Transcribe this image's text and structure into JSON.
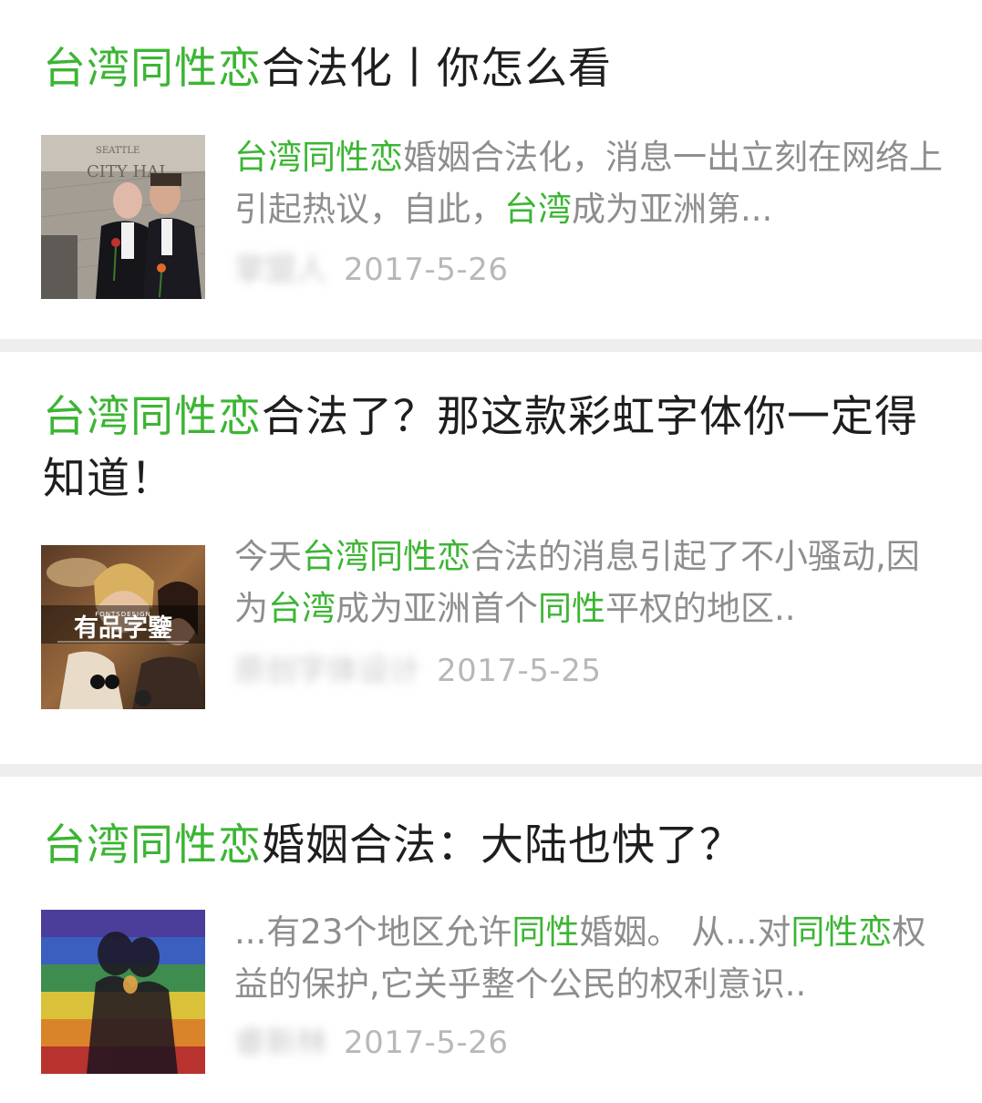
{
  "results": [
    {
      "title": {
        "highlight": "台湾同性恋",
        "rest": "合法化丨你怎么看"
      },
      "thumbnail": "seattle-city-hall-couple-photo",
      "thumbnail_text": "SEATTLE CITY HALL",
      "snippet": [
        {
          "text": "台湾同性恋",
          "hl": true
        },
        {
          "text": "婚姻合法化，消息一出立刻在网络上引起热议，自此，",
          "hl": false
        },
        {
          "text": "台湾",
          "hl": true
        },
        {
          "text": "成为亚洲第...",
          "hl": false
        }
      ],
      "source": "掌盟人",
      "date": "2017-5-26"
    },
    {
      "title": {
        "highlight": "台湾同性恋",
        "rest": "合法了？那这款彩虹字体你一定得知道！"
      },
      "thumbnail": "font-design-women-photo",
      "thumbnail_text": "有品字鑒",
      "thumbnail_subtext": "FONTSDESIGN",
      "snippet": [
        {
          "text": "今天",
          "hl": false
        },
        {
          "text": "台湾同性恋",
          "hl": true
        },
        {
          "text": "合法的消息引起了不小骚动,因为",
          "hl": false
        },
        {
          "text": "台湾",
          "hl": true
        },
        {
          "text": "成为亚洲首个",
          "hl": false
        },
        {
          "text": "同性",
          "hl": true
        },
        {
          "text": "平权的地区..",
          "hl": false
        }
      ],
      "source": "原创字体设计",
      "date": "2017-5-25"
    },
    {
      "title": {
        "highlight": "台湾同性恋",
        "rest": "婚姻合法：大陆也快了？"
      },
      "thumbnail": "rainbow-flag-silhouette-photo",
      "snippet": [
        {
          "text": "...有23个地区允许",
          "hl": false
        },
        {
          "text": "同性",
          "hl": true
        },
        {
          "text": "婚姻。 从...对",
          "hl": false
        },
        {
          "text": "同性恋",
          "hl": true
        },
        {
          "text": "权益的保护,它关乎整个公民的权利意识..",
          "hl": false
        }
      ],
      "source": "睿新林",
      "date": "2017-5-26"
    }
  ],
  "colors": {
    "highlight": "#3cb534",
    "title": "#1e1e1e",
    "snippet": "#8e8e8e",
    "meta": "#b8b8b8",
    "divider": "#eeeeee"
  }
}
